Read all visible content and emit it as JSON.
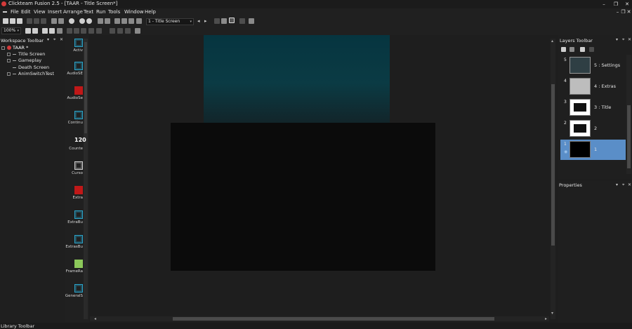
{
  "window": {
    "title": "Clickteam Fusion 2.5 - [TAAR - Title Screen*]",
    "controls": [
      "–",
      "❐",
      "✕"
    ]
  },
  "menubar": {
    "items": [
      "File",
      "Edit",
      "View",
      "Insert",
      "Arrange",
      "Text",
      "Run",
      "Tools",
      "Window",
      "Help"
    ],
    "mdi_controls": [
      "–",
      "❐",
      "✕"
    ]
  },
  "toolbar": {
    "frame_select": "1 - Title Screen",
    "zoom": "100%"
  },
  "workspace": {
    "title": "Workspace Toolbar",
    "root": "TAAR *",
    "frames": [
      "Title Screen",
      "Gameplay",
      "Death Screen",
      "AnimSwitchTest"
    ]
  },
  "objects": {
    "items": [
      {
        "label": "Activ",
        "icon": "active-object-icon",
        "color": "#2aa3c8"
      },
      {
        "label": "AudioSE",
        "icon": "audio-object-icon",
        "color": "#2aa3c8"
      },
      {
        "label": "AudioSe",
        "icon": "red-object-icon",
        "color": "#c01818"
      },
      {
        "label": "Continu",
        "icon": "continue-object-icon",
        "color": "#2aa3c8"
      },
      {
        "label": "Counte",
        "icon": "counter-object-icon",
        "color": "#ffffff",
        "glyph": "120"
      },
      {
        "label": "Curso",
        "icon": "cursor-object-icon",
        "color": "#cccccc"
      },
      {
        "label": "Extra",
        "icon": "red-object-icon",
        "color": "#c01818"
      },
      {
        "label": "ExtraBu",
        "icon": "extras-button-icon",
        "color": "#2aa3c8"
      },
      {
        "label": "ExtrasBu",
        "icon": "extras-button-icon",
        "color": "#2aa3c8"
      },
      {
        "label": "FrameRa",
        "icon": "framerate-object-icon",
        "color": "#8cc85a"
      },
      {
        "label": "GeneralS",
        "icon": "general-object-icon",
        "color": "#2aa3c8"
      }
    ]
  },
  "layers": {
    "title": "Layers Toolbar",
    "items": [
      {
        "num": "5",
        "name": "5 : Settings",
        "selected": false
      },
      {
        "num": "4",
        "name": "4 : Extras",
        "selected": false
      },
      {
        "num": "3",
        "name": "3 : Title",
        "selected": false
      },
      {
        "num": "2",
        "name": "2",
        "selected": false
      },
      {
        "num": "1",
        "name": "1",
        "selected": true
      }
    ]
  },
  "properties": {
    "title": "Properties"
  },
  "bottom": {
    "library_title": "Library Toolbar"
  }
}
